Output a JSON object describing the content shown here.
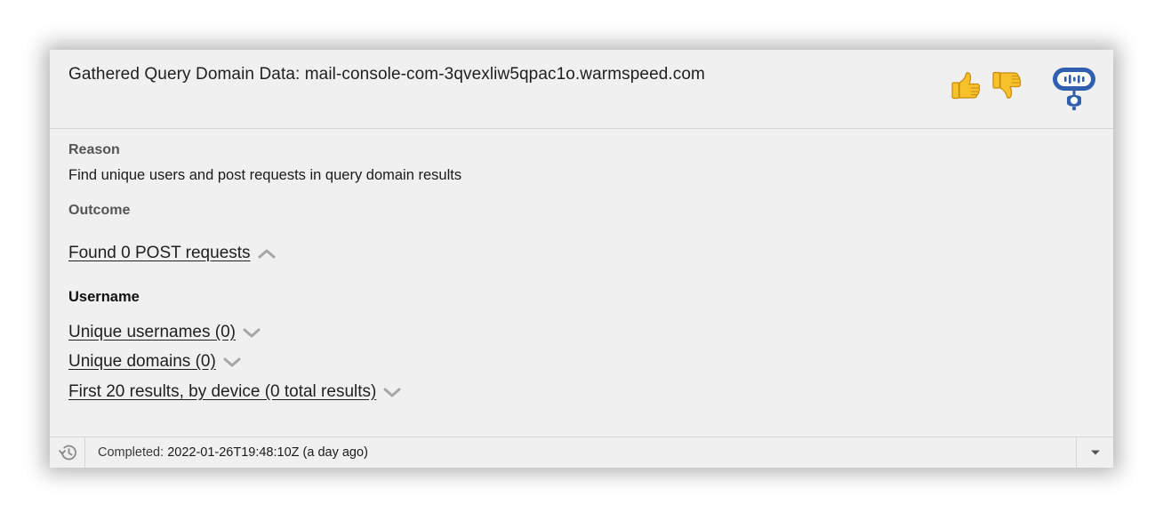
{
  "header": {
    "title": "Gathered Query Domain Data: mail-console-com-3qvexliw5qpac1o.warmspeed.com",
    "thumbs_up_icon": "thumbs-up-icon",
    "thumbs_down_icon": "thumbs-down-icon",
    "bot_icon": "robot-avatar-icon",
    "bot_color": "#2f5fae"
  },
  "reason": {
    "label": "Reason",
    "text": "Find unique users and post requests in query domain results"
  },
  "outcome": {
    "label": "Outcome",
    "post_requests_link": "Found 0 POST requests",
    "post_requests_state": "expanded",
    "username_heading": "Username",
    "sections": [
      {
        "label": "Unique usernames (0)",
        "state": "collapsed"
      },
      {
        "label": "Unique domains (0)",
        "state": "collapsed"
      },
      {
        "label": "First 20 results, by device (0 total results)",
        "state": "collapsed"
      }
    ]
  },
  "footer": {
    "history_icon": "history-icon",
    "completed_label": "Completed:",
    "completed_value": "2022-01-26T19:48:10Z (a day ago)",
    "expand_icon": "caret-down-icon"
  },
  "colors": {
    "card_background": "#f0f0f0",
    "chevron": "#9e9e9e",
    "thumb_yellow": "#f7c12b"
  }
}
